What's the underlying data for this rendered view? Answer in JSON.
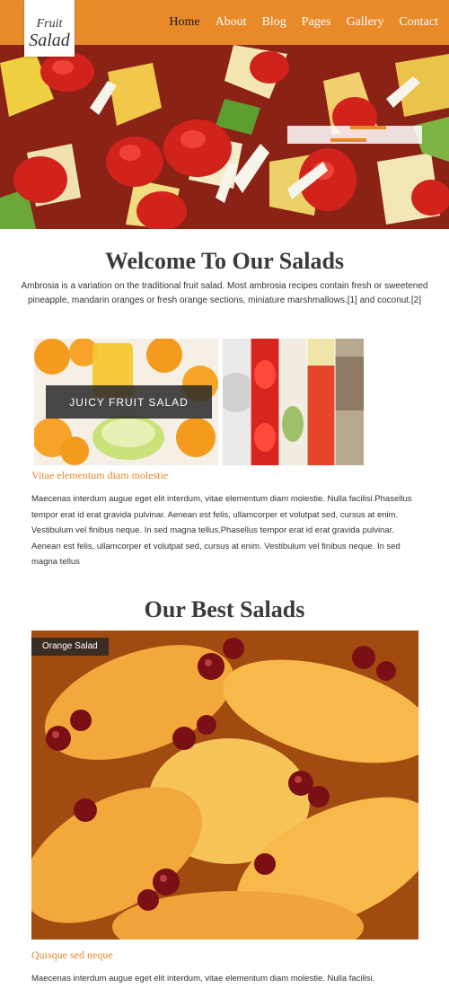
{
  "header": {
    "logo_line1": "Fruit",
    "logo_line2": "Salad",
    "nav": [
      {
        "label": "Home"
      },
      {
        "label": "About"
      },
      {
        "label": "Blog"
      },
      {
        "label": "Pages"
      },
      {
        "label": "Gallery"
      },
      {
        "label": "Contact"
      }
    ],
    "accent_color": "#e8892a"
  },
  "welcome": {
    "title": "Welcome To Our Salads",
    "text": "Ambrosia is a variation on the traditional fruit salad. Most ambrosia recipes contain fresh or sweetened pineapple, mandarin oranges or fresh orange sections, miniature marshmallows.[1] and coconut.[2]"
  },
  "feature": {
    "image_label": "JUICY FRUIT SALAD",
    "link": "Vitae elementum diam molestie",
    "paragraph": "Maecenas interdum augue eget elit interdum, vitae elementum diam molestie. Nulla facilisi.Phasellus tempor erat id erat gravida pulvinar. Aenean est felis, ullamcorper et volutpat sed, cursus at enim. Vestibulum vel finibus neque. In sed magna tellus.Phasellus tempor erat id erat gravida pulvinar. Aenean est felis, ullamcorper et volutpat sed, cursus at enim. Vestibulum vel finibus neque. In sed magna tellus"
  },
  "best": {
    "title": "Our Best Salads",
    "item_tag": "Orange Salad",
    "link": "Quisque sed neque",
    "paragraph": "Maecenas interdum augue eget elit interdum, vitae elementum diam molestie. Nulla facilisi."
  }
}
